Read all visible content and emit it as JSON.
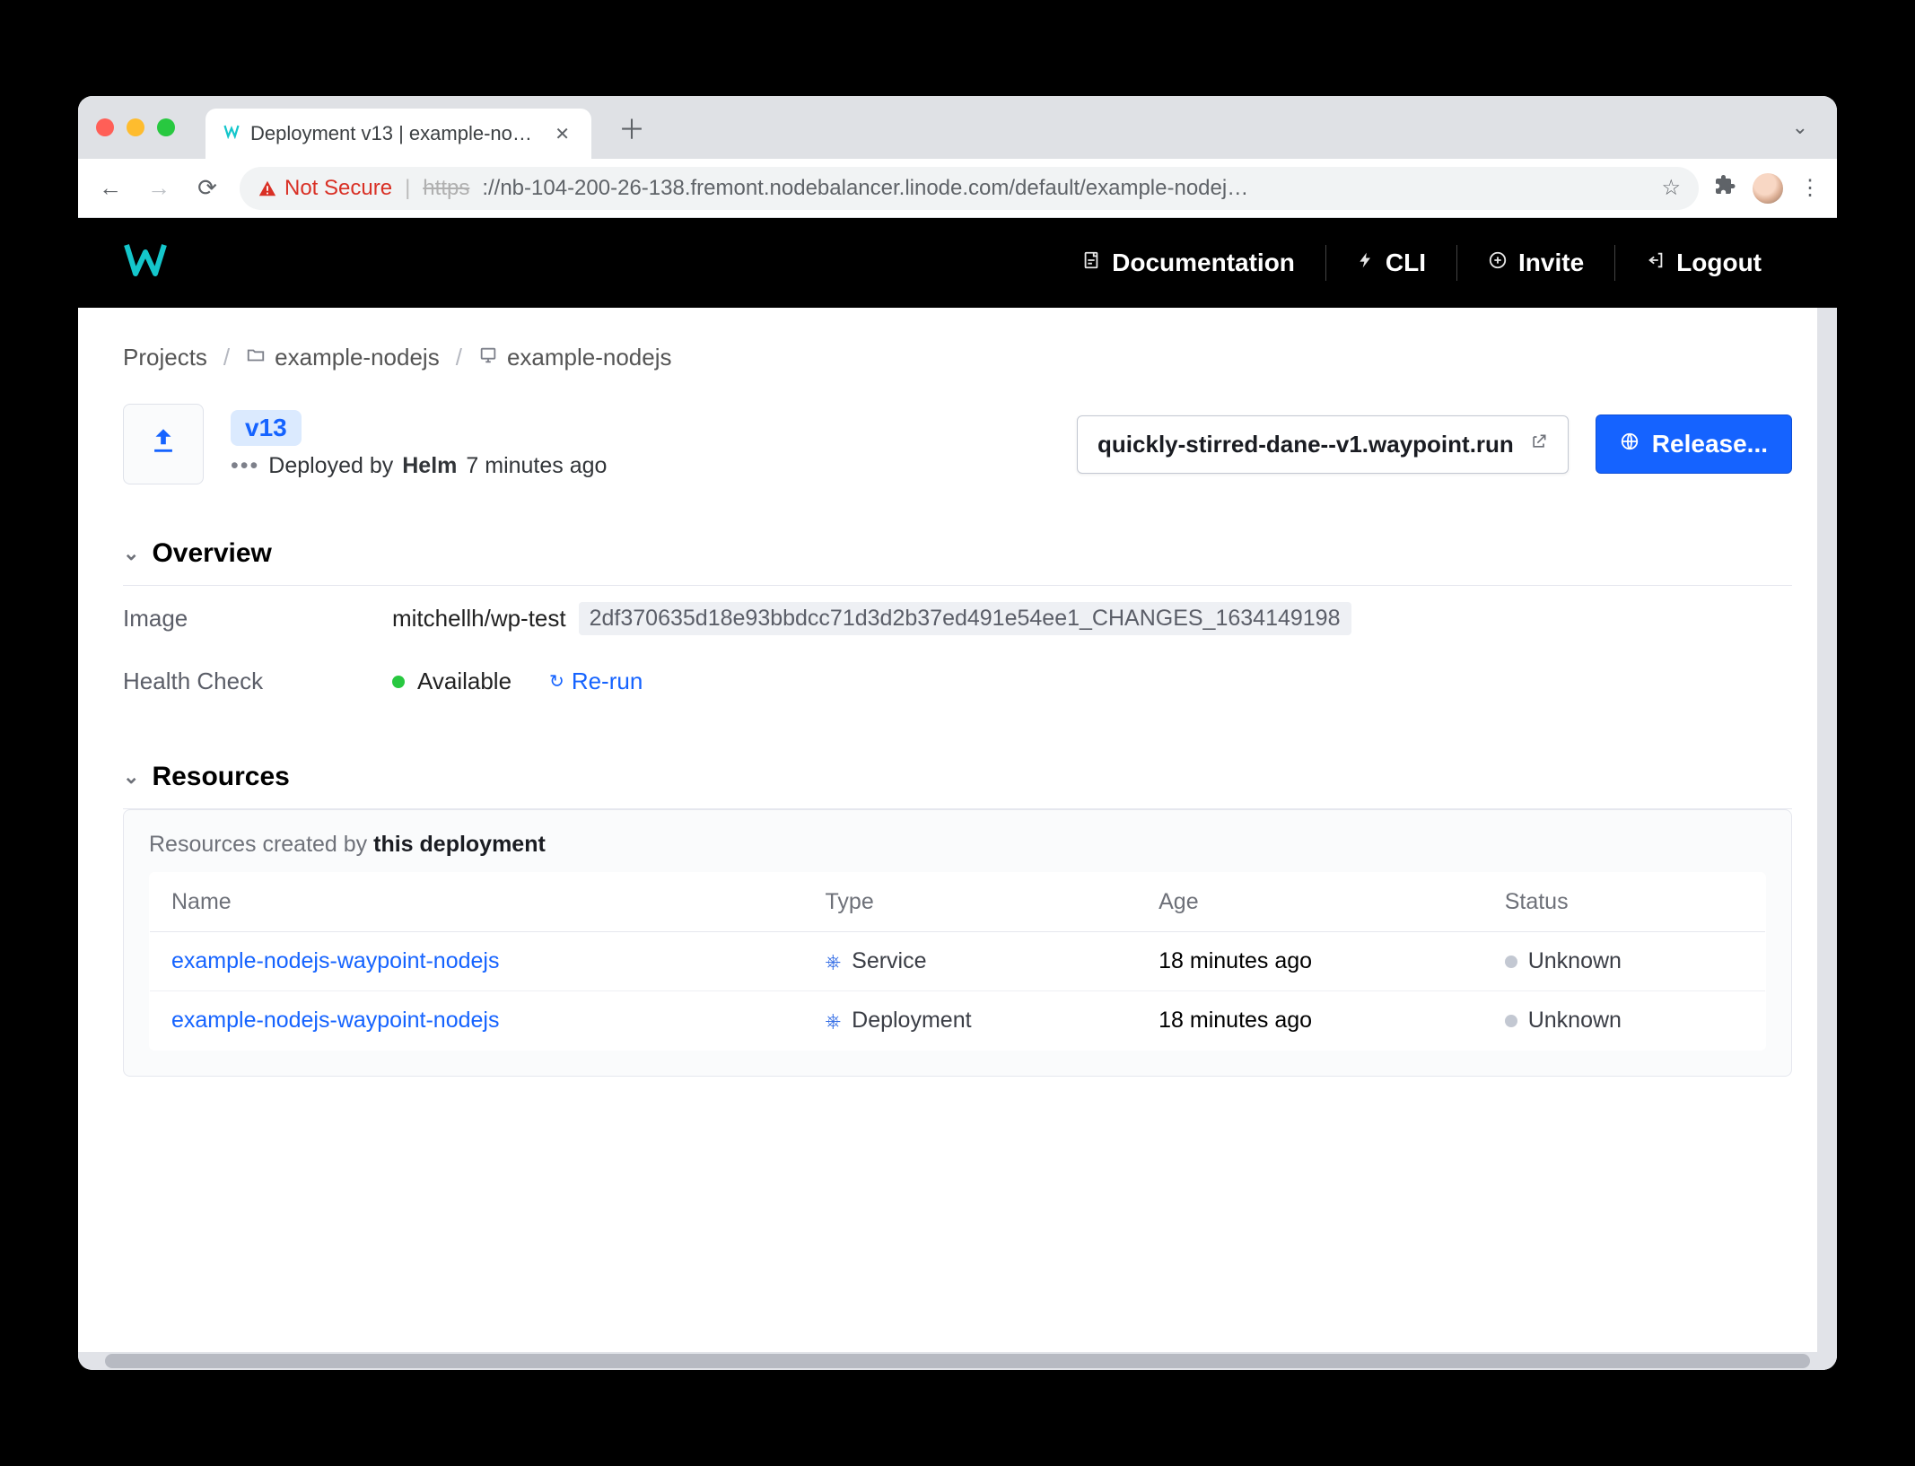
{
  "browser": {
    "tab_title": "Deployment v13 | example-nod…",
    "not_secure": "Not Secure",
    "url_scheme": "https",
    "url_rest": "://nb-104-200-26-138.fremont.nodebalancer.linode.com/default/example-nodej…"
  },
  "header": {
    "nav": {
      "docs": "Documentation",
      "cli": "CLI",
      "invite": "Invite",
      "logout": "Logout"
    }
  },
  "breadcrumbs": {
    "root": "Projects",
    "project": "example-nodejs",
    "app": "example-nodejs"
  },
  "deployment": {
    "version": "v13",
    "deployed_prefix": "Deployed by",
    "deployer": "Helm",
    "when": "7 minutes ago",
    "url": "quickly-stirred-dane--v1.waypoint.run",
    "release_btn": "Release..."
  },
  "sections": {
    "overview": "Overview",
    "resources": "Resources"
  },
  "overview": {
    "image_label": "Image",
    "image_name": "mitchellh/wp-test",
    "image_hash": "2df370635d18e93bbdcc71d3d2b37ed491e54ee1_CHANGES_1634149198",
    "health_label": "Health Check",
    "health_value": "Available",
    "rerun": "Re-run"
  },
  "resources": {
    "caption_prefix": "Resources created by ",
    "caption_strong": "this deployment",
    "columns": {
      "name": "Name",
      "type": "Type",
      "age": "Age",
      "status": "Status"
    },
    "rows": [
      {
        "name": "example-nodejs-waypoint-nodejs",
        "type": "Service",
        "age": "18 minutes ago",
        "status": "Unknown"
      },
      {
        "name": "example-nodejs-waypoint-nodejs",
        "type": "Deployment",
        "age": "18 minutes ago",
        "status": "Unknown"
      }
    ]
  }
}
